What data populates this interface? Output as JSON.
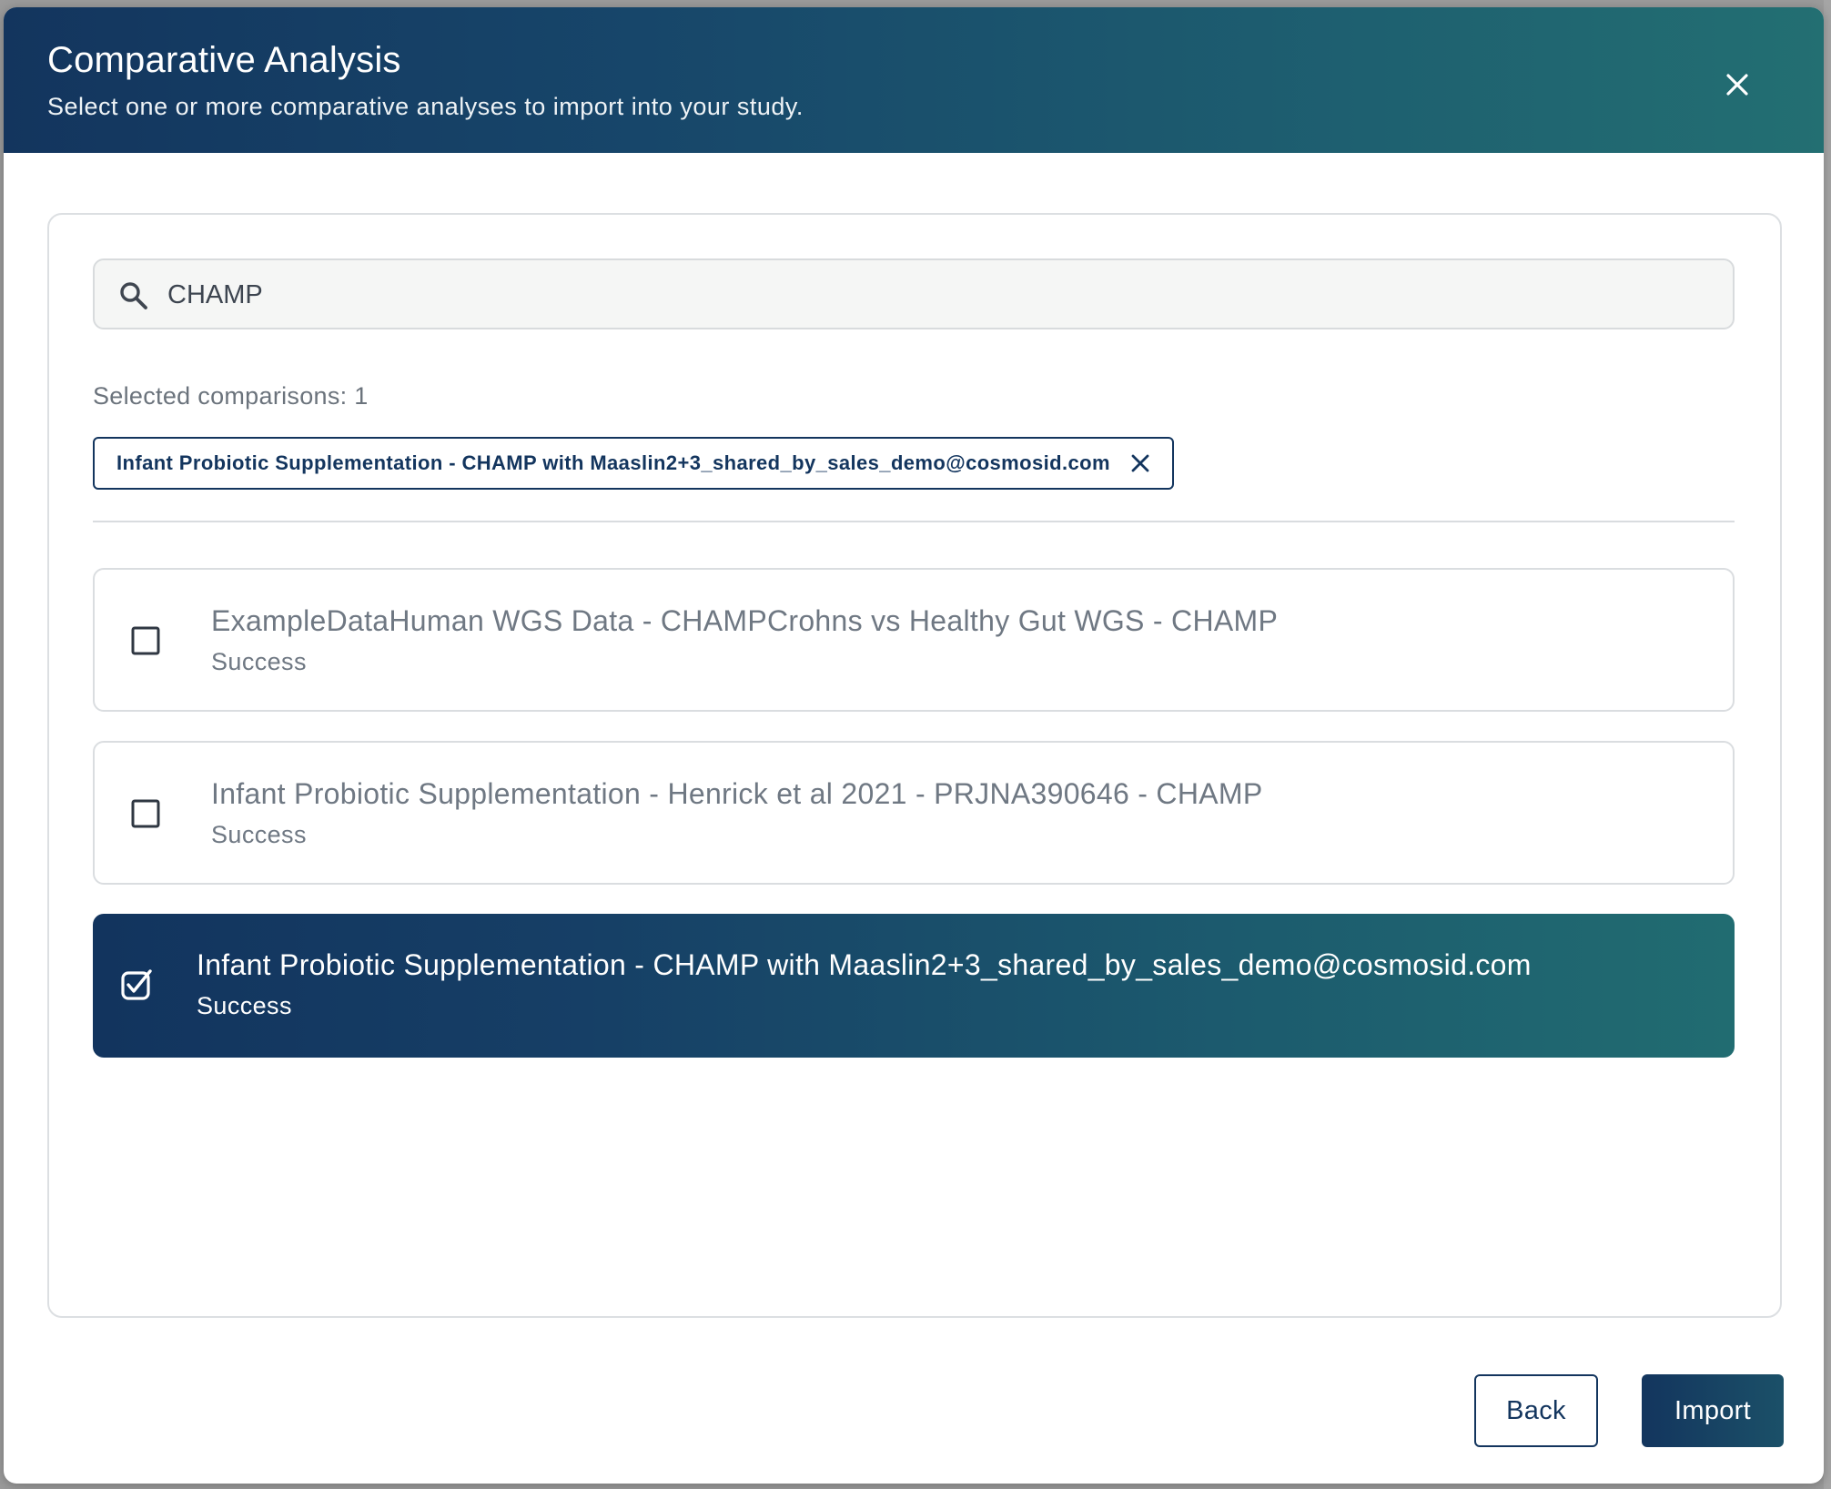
{
  "dialog": {
    "title": "Comparative Analysis",
    "subtitle": "Select one or more comparative analyses to import into your study.",
    "close_icon": "close-icon"
  },
  "search": {
    "value": "CHAMP",
    "placeholder": "",
    "icon": "search-icon"
  },
  "selection": {
    "count_label": "Selected comparisons: 1",
    "chips": [
      {
        "label": "Infant Probiotic Supplementation - CHAMP with Maaslin2+3_shared_by_sales_demo@cosmosid.com"
      }
    ]
  },
  "options": [
    {
      "title": "ExampleDataHuman WGS Data - CHAMPCrohns vs Healthy Gut WGS - CHAMP",
      "status": "Success",
      "checked": false
    },
    {
      "title": "Infant Probiotic Supplementation - Henrick et al 2021 - PRJNA390646 - CHAMP",
      "status": "Success",
      "checked": false
    },
    {
      "title": "Infant Probiotic Supplementation - CHAMP with Maaslin2+3_shared_by_sales_demo@cosmosid.com",
      "status": "Success",
      "checked": true
    }
  ],
  "footer": {
    "back_label": "Back",
    "import_label": "Import"
  },
  "colors": {
    "brand_navy": "#13355e",
    "brand_teal": "#236f72",
    "muted_text": "#6f7883",
    "border": "#dadde0"
  }
}
